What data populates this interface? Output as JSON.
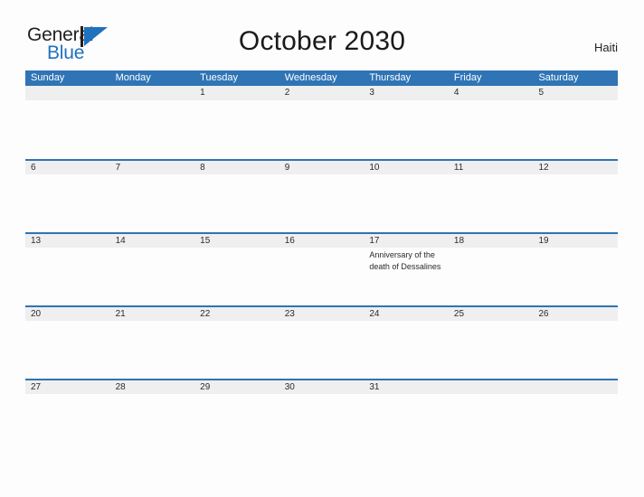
{
  "brand": {
    "name_part1": "General",
    "name_part2": "Blue",
    "logo_icon": "blue-triangle-flag-icon",
    "colors": {
      "dark": "#231f20",
      "blue": "#1f72bd"
    }
  },
  "header": {
    "title": "October 2030",
    "region": "Haiti"
  },
  "calendar": {
    "month": "October",
    "year": "2030",
    "accent_color": "#2f74b5",
    "band_color": "#efefef",
    "weekdays": [
      "Sunday",
      "Monday",
      "Tuesday",
      "Wednesday",
      "Thursday",
      "Friday",
      "Saturday"
    ],
    "weeks": [
      [
        {
          "date": "",
          "event": ""
        },
        {
          "date": "",
          "event": ""
        },
        {
          "date": "1",
          "event": ""
        },
        {
          "date": "2",
          "event": ""
        },
        {
          "date": "3",
          "event": ""
        },
        {
          "date": "4",
          "event": ""
        },
        {
          "date": "5",
          "event": ""
        }
      ],
      [
        {
          "date": "6",
          "event": ""
        },
        {
          "date": "7",
          "event": ""
        },
        {
          "date": "8",
          "event": ""
        },
        {
          "date": "9",
          "event": ""
        },
        {
          "date": "10",
          "event": ""
        },
        {
          "date": "11",
          "event": ""
        },
        {
          "date": "12",
          "event": ""
        }
      ],
      [
        {
          "date": "13",
          "event": ""
        },
        {
          "date": "14",
          "event": ""
        },
        {
          "date": "15",
          "event": ""
        },
        {
          "date": "16",
          "event": ""
        },
        {
          "date": "17",
          "event": "Anniversary of the death of Dessalines"
        },
        {
          "date": "18",
          "event": ""
        },
        {
          "date": "19",
          "event": ""
        }
      ],
      [
        {
          "date": "20",
          "event": ""
        },
        {
          "date": "21",
          "event": ""
        },
        {
          "date": "22",
          "event": ""
        },
        {
          "date": "23",
          "event": ""
        },
        {
          "date": "24",
          "event": ""
        },
        {
          "date": "25",
          "event": ""
        },
        {
          "date": "26",
          "event": ""
        }
      ],
      [
        {
          "date": "27",
          "event": ""
        },
        {
          "date": "28",
          "event": ""
        },
        {
          "date": "29",
          "event": ""
        },
        {
          "date": "30",
          "event": ""
        },
        {
          "date": "31",
          "event": ""
        },
        {
          "date": "",
          "event": ""
        },
        {
          "date": "",
          "event": ""
        }
      ]
    ]
  }
}
